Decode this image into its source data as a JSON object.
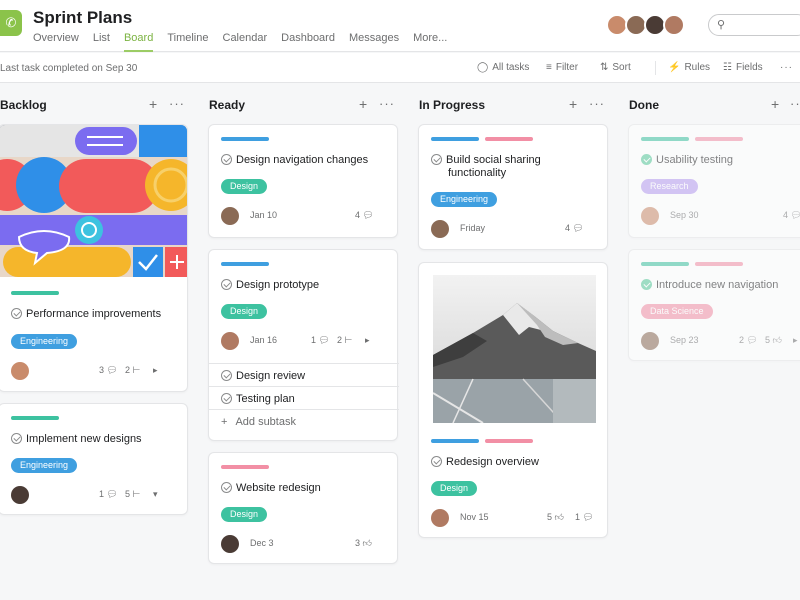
{
  "header": {
    "title": "Sprint Plans",
    "tabs": [
      "Overview",
      "List",
      "Board",
      "Timeline",
      "Calendar",
      "Dashboard",
      "Messages",
      "More..."
    ],
    "active_tab": "Board"
  },
  "toolbar": {
    "last_task": "Last task completed on Sep 30",
    "all_tasks": "All tasks",
    "filter": "Filter",
    "sort": "Sort",
    "rules": "Rules",
    "fields": "Fields"
  },
  "columns": {
    "backlog": "Backlog",
    "ready": "Ready",
    "in_progress": "In Progress",
    "done": "Done"
  },
  "cards": {
    "perf": {
      "title": "Performance improvements",
      "tag": "Engineering",
      "comments": "3",
      "subtasks": "2"
    },
    "impl": {
      "title": "Implement new designs",
      "tag": "Engineering",
      "comments": "1",
      "subtasks": "5"
    },
    "nav": {
      "title": "Design navigation changes",
      "tag": "Design",
      "date": "Jan 10",
      "comments": "4"
    },
    "proto": {
      "title": "Design prototype",
      "tag": "Design",
      "date": "Jan 16",
      "comments": "1",
      "subtasks": "2",
      "sub1": "Design review",
      "sub2": "Testing plan",
      "add": "Add subtask"
    },
    "web": {
      "title": "Website redesign",
      "tag": "Design",
      "date": "Dec 3",
      "likes": "3"
    },
    "social": {
      "title1": "Build social sharing",
      "title2": "functionality",
      "tag": "Engineering",
      "date": "Friday",
      "comments": "4"
    },
    "redesign": {
      "title": "Redesign overview",
      "tag": "Design",
      "date": "Nov 15",
      "likes": "5",
      "comments": "1"
    },
    "usability": {
      "title": "Usability testing",
      "tag": "Research",
      "date": "Sep 30",
      "comments": "4"
    },
    "intro": {
      "title": "Introduce new navigation",
      "tag": "Data Science",
      "date": "Sep 23",
      "comments": "2",
      "likes": "5"
    }
  },
  "colors": {
    "engineering": "#3f9fe0",
    "design": "#3dc2a0",
    "research": "#b59cf0",
    "data_science": "#f28fa5",
    "stripe_blue": "#3f9fe0",
    "stripe_pink": "#f28fa5",
    "stripe_teal": "#3dc2a0",
    "accent": "#9ccc65"
  }
}
